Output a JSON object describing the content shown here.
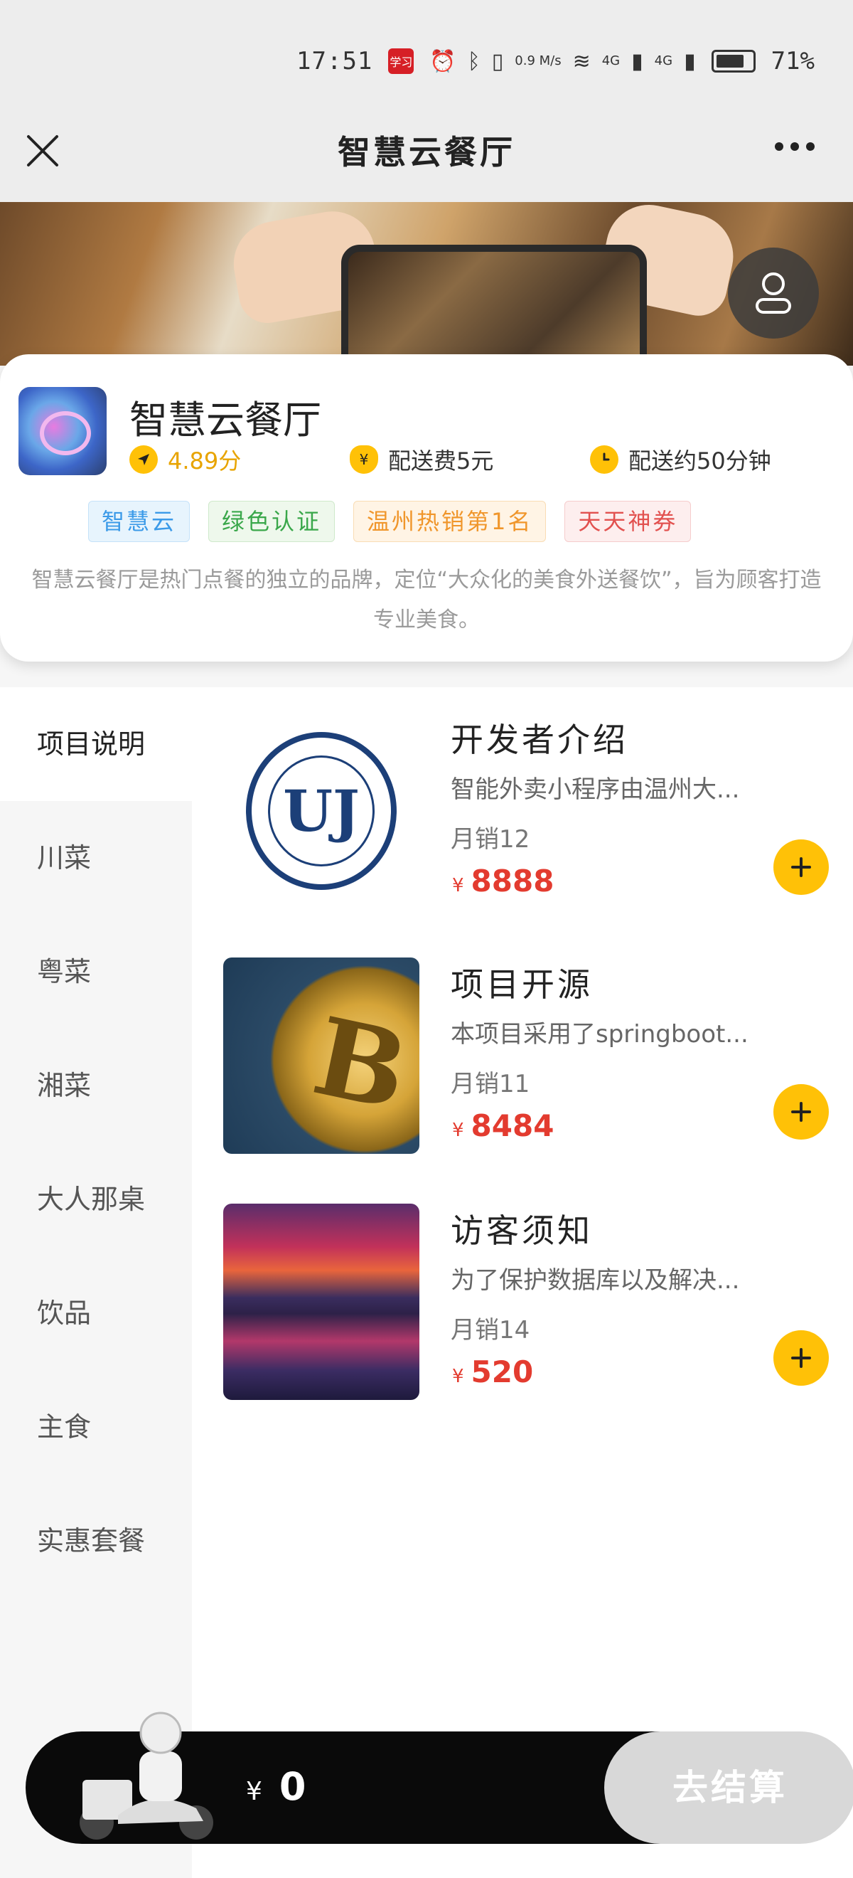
{
  "status_bar": {
    "time": "17:51",
    "app_badge": "学习",
    "network_speed": "0.9 M/s",
    "signal_1": "4G",
    "signal_2": "4G",
    "battery": "71%"
  },
  "nav": {
    "title": "智慧云餐厅",
    "close_icon": "close-icon",
    "more_icon": "more-dots-icon"
  },
  "shop": {
    "name": "智慧云餐厅",
    "rating": "4.89分",
    "delivery_fee": "配送费5元",
    "delivery_time": "配送约50分钟",
    "tags": [
      "智慧云",
      "绿色认证",
      "温州热销第1名",
      "天天神券"
    ],
    "description": "智慧云餐厅是热门点餐的独立的品牌，定位“大众化的美食外送餐饮”，旨为顾客打造专业美食。"
  },
  "sidebar": {
    "items": [
      "项目说明",
      "川菜",
      "粤菜",
      "湘菜",
      "大人那桌",
      "饮品",
      "主食",
      "实惠套餐"
    ],
    "active_index": 0
  },
  "dishes": [
    {
      "name": "开发者介绍",
      "desc": "智能外卖小程序由温州大...",
      "sales": "月销12",
      "currency": "¥",
      "price": "8888",
      "image": "wenzhou-university-logo"
    },
    {
      "name": "项目开源",
      "desc": "本项目采用了springboot...",
      "sales": "月销11",
      "currency": "¥",
      "price": "8484",
      "image": "bitcoin-photo"
    },
    {
      "name": "访客须知",
      "desc": "为了保护数据库以及解决...",
      "sales": "月销14",
      "currency": "¥",
      "price": "520",
      "image": "lake-sunset-photo"
    }
  ],
  "cart": {
    "currency": "¥",
    "total": "0",
    "checkout_label": "去结算"
  },
  "colors": {
    "accent": "#ffc107",
    "price": "#e33b2f",
    "cart_bar": "#0a0a0a",
    "checkout_disabled": "#d8d8d8"
  }
}
